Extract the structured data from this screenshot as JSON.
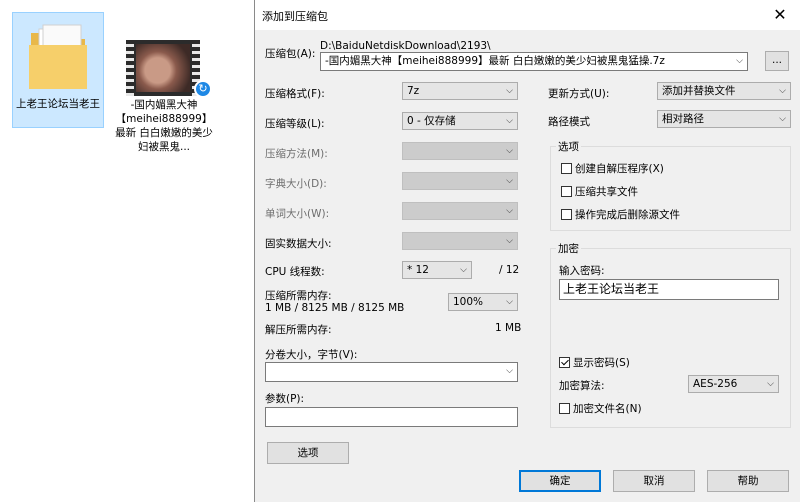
{
  "desktop": {
    "folder": {
      "label": "上老王论坛当老王"
    },
    "video": {
      "label": "-国内媚黑大神【meihei888999】最新 白白嫩嫩的美少妇被黑鬼...",
      "badge": "↻"
    }
  },
  "dialog": {
    "title": "添加到压缩包",
    "close": "✕",
    "archive": {
      "label": "压缩包(A):",
      "path": "D:\\BaiduNetdiskDownload\\2193\\",
      "name": "-国内媚黑大神【meihei888999】最新 白白嫩嫩的美少妇被黑鬼猛操.7z",
      "browse": "..."
    },
    "format": {
      "label": "压缩格式(F):",
      "value": "7z"
    },
    "level": {
      "label": "压缩等级(L):",
      "value": "0 - 仅存储"
    },
    "method": {
      "label": "压缩方法(M):"
    },
    "dict": {
      "label": "字典大小(D):"
    },
    "word": {
      "label": "单词大小(W):"
    },
    "solid": {
      "label": "固实数据大小:"
    },
    "cpu": {
      "label": "CPU 线程数:",
      "value": "* 12",
      "max": "/ 12"
    },
    "mem_compress": {
      "label": "压缩所需内存:",
      "detail": "1 MB / 8125 MB / 8125 MB",
      "value": "100%"
    },
    "mem_decompress": {
      "label": "解压所需内存:",
      "value": "1 MB"
    },
    "volume": {
      "label": "分卷大小，字节(V):",
      "value": ""
    },
    "params": {
      "label": "参数(P):",
      "value": ""
    },
    "options_button": "选项",
    "update": {
      "label": "更新方式(U):",
      "value": "添加并替换文件"
    },
    "path_mode": {
      "label": "路径模式",
      "value": "相对路径"
    },
    "options_group": {
      "title": "选项",
      "sfx": "创建自解压程序(X)",
      "shared": "压缩共享文件",
      "delete": "操作完成后删除源文件"
    },
    "encrypt_group": {
      "title": "加密",
      "pw_label": "输入密码:",
      "pw_value": "上老王论坛当老王",
      "show_pw": "显示密码(S)",
      "algo_label": "加密算法:",
      "algo_value": "AES-256",
      "encrypt_names": "加密文件名(N)"
    },
    "ok": "确定",
    "cancel": "取消",
    "help": "帮助"
  }
}
